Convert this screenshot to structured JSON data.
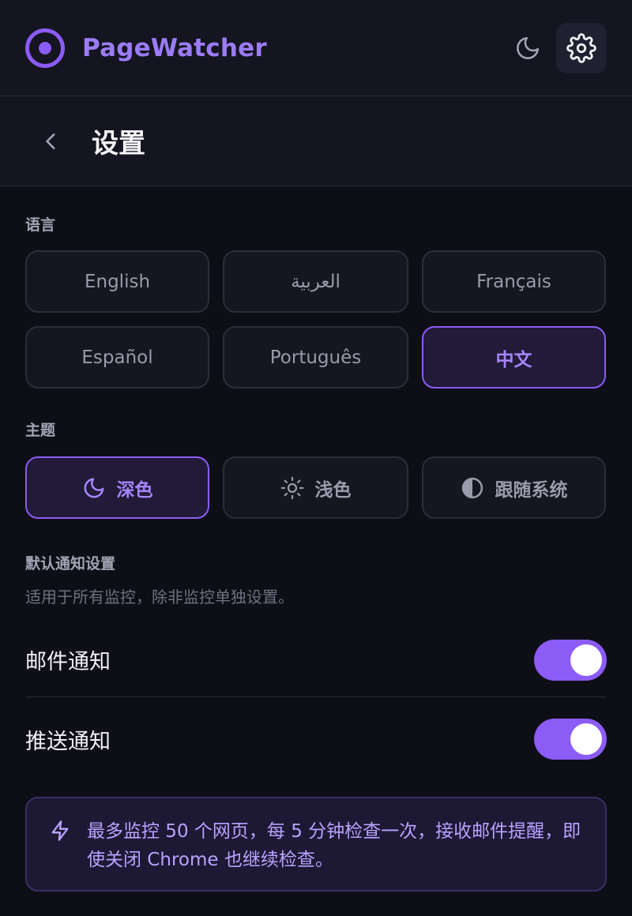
{
  "header": {
    "app_title": "PageWatcher"
  },
  "subheader": {
    "title": "设置"
  },
  "language": {
    "label": "语言",
    "options": [
      "English",
      "العربية",
      "Français",
      "Español",
      "Português",
      "中文"
    ],
    "selected": "中文"
  },
  "theme": {
    "label": "主题",
    "options": [
      {
        "label": "深色",
        "icon": "moon-icon"
      },
      {
        "label": "浅色",
        "icon": "sun-icon"
      },
      {
        "label": "跟随系统",
        "icon": "contrast-icon"
      }
    ],
    "selected": "深色"
  },
  "notifications": {
    "label": "默认通知设置",
    "description": "适用于所有监控，除非监控单独设置。",
    "email_label": "邮件通知",
    "email_enabled": true,
    "push_label": "推送通知",
    "push_enabled": true
  },
  "info": {
    "icon": "lightning-icon",
    "text": "最多监控 50 个网页，每 5 分钟检查一次，接收邮件提醒，即使关闭 Chrome 也继续检查。"
  },
  "colors": {
    "accent": "#8b5cf6",
    "background": "#0e0f16",
    "panel": "#141520"
  }
}
